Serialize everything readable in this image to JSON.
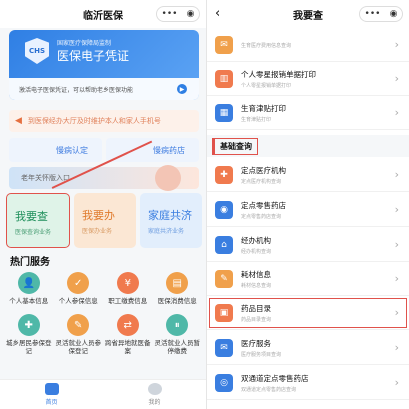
{
  "left": {
    "title": "临沂医保",
    "capsule": {
      "more": "•••",
      "close": "◉"
    },
    "card": {
      "badge": "CHS",
      "sub": "国家医疗保障局监制",
      "main": "医保电子凭证",
      "tip": "激活电子医保凭证，可以帮助老乡医保功能",
      "tip_btn": "▶"
    },
    "notice": "到医保经办大厅及时维护本人和家人手机号",
    "duo": [
      "慢病认定",
      "慢病药店"
    ],
    "elder": "老年关怀版入口",
    "tiles": [
      {
        "t1": "我要查",
        "t2": "医保查询业务"
      },
      {
        "t1": "我要办",
        "t2": "医保办业务"
      },
      {
        "t1": "家庭共济",
        "t2": "家庭共济业务"
      }
    ],
    "hot_title": "热门服务",
    "services": [
      {
        "label": "个人基本信息",
        "icon": "person-icon",
        "color": "#4fb8a8",
        "glyph": "👤"
      },
      {
        "label": "个人参保信息",
        "icon": "document-icon",
        "color": "#f0a04b",
        "glyph": "✓"
      },
      {
        "label": "职工缴费信息",
        "icon": "coin-icon",
        "color": "#f07a4e",
        "glyph": "¥"
      },
      {
        "label": "医保消费信息",
        "icon": "card-icon",
        "color": "#f0a04b",
        "glyph": "▤"
      },
      {
        "label": "城乡居民参保登记",
        "icon": "people-icon",
        "color": "#4fb8a8",
        "glyph": "✚"
      },
      {
        "label": "灵活就业人员参保登记",
        "icon": "worker-icon",
        "color": "#f0a04b",
        "glyph": "✎"
      },
      {
        "label": "跨省异地就医备案",
        "icon": "transfer-icon",
        "color": "#f07a4e",
        "glyph": "⇄"
      },
      {
        "label": "灵活就业人员暂停缴费",
        "icon": "pause-icon",
        "color": "#4fb8a8",
        "glyph": "⏸"
      }
    ],
    "tabs": [
      {
        "label": "首页"
      },
      {
        "label": "我的"
      }
    ]
  },
  "right": {
    "title": "我要查",
    "back": "‹",
    "capsule": {
      "more": "•••",
      "close": "◉"
    },
    "top_rows": [
      {
        "title": "",
        "sub": "生育医疗费用信息查询",
        "color": "#f0a04b",
        "glyph": "✉"
      },
      {
        "title": "个人零星报销单据打印",
        "sub": "个人零星报销单据打印",
        "color": "#f07a4e",
        "glyph": "▥"
      },
      {
        "title": "生育津贴打印",
        "sub": "生育津贴打印",
        "color": "#3a7ee0",
        "glyph": "▦"
      }
    ],
    "section": "基础查询",
    "rows": [
      {
        "title": "定点医疗机构",
        "sub": "定点医疗机构查询",
        "color": "#f07a4e",
        "glyph": "✚"
      },
      {
        "title": "定点零售药店",
        "sub": "定点零售药店查询",
        "color": "#3a7ee0",
        "glyph": "◉"
      },
      {
        "title": "经办机构",
        "sub": "经办机构查询",
        "color": "#3a7ee0",
        "glyph": "⌂"
      },
      {
        "title": "耗材信息",
        "sub": "耗材信息查询",
        "color": "#f0a04b",
        "glyph": "✎"
      },
      {
        "title": "药品目录",
        "sub": "药品目录查询",
        "color": "#f07a4e",
        "glyph": "▣"
      },
      {
        "title": "医疗服务",
        "sub": "医疗服务项目查询",
        "color": "#3a7ee0",
        "glyph": "✉"
      },
      {
        "title": "双通道定点零售药店",
        "sub": "双通道定点零售药店查询",
        "color": "#3a7ee0",
        "glyph": "◎"
      }
    ],
    "chevron": "›"
  }
}
